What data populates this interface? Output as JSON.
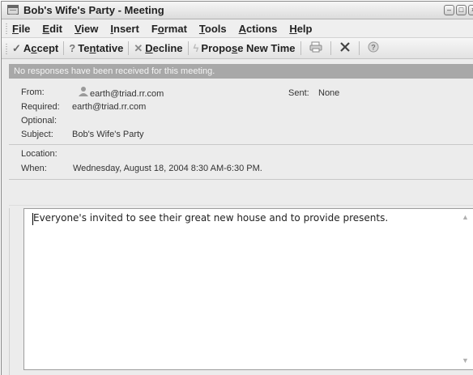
{
  "window": {
    "title": "Bob's Wife's Party - Meeting"
  },
  "menu": [
    {
      "pre": "",
      "u": "F",
      "post": "ile"
    },
    {
      "pre": "",
      "u": "E",
      "post": "dit"
    },
    {
      "pre": "",
      "u": "V",
      "post": "iew"
    },
    {
      "pre": "",
      "u": "I",
      "post": "nsert"
    },
    {
      "pre": "F",
      "u": "o",
      "post": "rmat"
    },
    {
      "pre": "",
      "u": "T",
      "post": "ools"
    },
    {
      "pre": "",
      "u": "A",
      "post": "ctions"
    },
    {
      "pre": "",
      "u": "H",
      "post": "elp"
    }
  ],
  "toolbar": {
    "accept": {
      "pre": "A",
      "u": "c",
      "post": "cept"
    },
    "tentative": {
      "pre": "Te",
      "u": "n",
      "post": "tative"
    },
    "decline": {
      "pre": "",
      "u": "D",
      "post": "ecline"
    },
    "propose": {
      "pre": "Propo",
      "u": "s",
      "post": "e New Time"
    }
  },
  "infobar": "No responses have been received for this meeting.",
  "header": {
    "from_label": "From:",
    "from_value": "earth@triad.rr.com",
    "sent_label": "Sent:",
    "sent_value": "None",
    "required_label": "Required:",
    "required_value": "earth@triad.rr.com",
    "optional_label": "Optional:",
    "optional_value": "",
    "subject_label": "Subject:",
    "subject_value": "Bob's Wife's Party",
    "location_label": "Location:",
    "location_value": "",
    "when_label": "When:",
    "when_value": "Wednesday, August 18, 2004 8:30 AM-6:30 PM."
  },
  "body": "Everyone's invited to see their great new house and to provide presents."
}
